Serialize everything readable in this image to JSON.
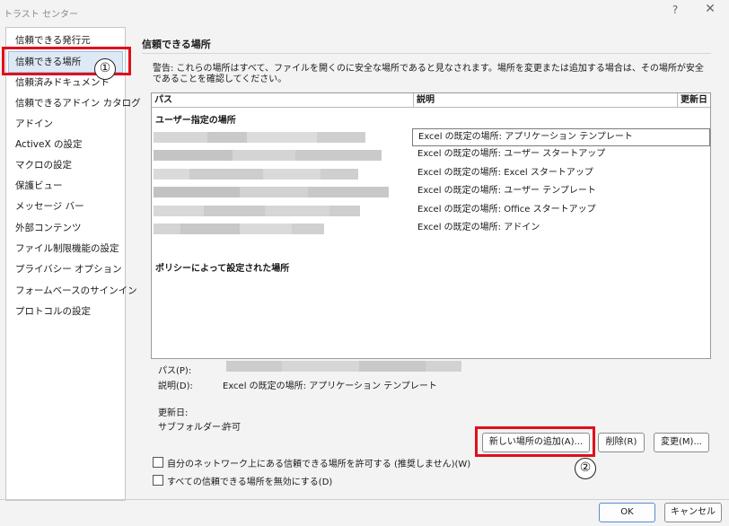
{
  "window": {
    "title": "トラスト センター",
    "help": "?",
    "close": "✕"
  },
  "sidebar": {
    "items": [
      {
        "label": "信頼できる発行元"
      },
      {
        "label": "信頼できる場所"
      },
      {
        "label": "信頼済みドキュメント"
      },
      {
        "label": "信頼できるアドイン カタログ"
      },
      {
        "label": "アドイン"
      },
      {
        "label": "ActiveX の設定"
      },
      {
        "label": "マクロの設定"
      },
      {
        "label": "保護ビュー"
      },
      {
        "label": "メッセージ バー"
      },
      {
        "label": "外部コンテンツ"
      },
      {
        "label": "ファイル制限機能の設定"
      },
      {
        "label": "プライバシー オプション"
      },
      {
        "label": "フォームベースのサインイン"
      },
      {
        "label": "プロトコルの設定"
      }
    ],
    "selected_index": 1
  },
  "main": {
    "title": "信頼できる場所",
    "warning": "警告: これらの場所はすべて、ファイルを開くのに安全な場所であると見なされます。場所を変更または追加する場合は、その場所が安全であることを確認してください。",
    "columns": {
      "path": "パス",
      "description": "説明",
      "modified": "更新日"
    },
    "user_group": "ユーザー指定の場所",
    "rows": [
      {
        "description": "Excel の既定の場所: アプリケーション テンプレート"
      },
      {
        "description": "Excel の既定の場所: ユーザー スタートアップ"
      },
      {
        "description": "Excel の既定の場所: Excel スタートアップ"
      },
      {
        "description": "Excel の既定の場所: ユーザー テンプレート"
      },
      {
        "description": "Excel の既定の場所: Office スタートアップ"
      },
      {
        "description": "Excel の既定の場所: アドイン"
      }
    ],
    "policy_group": "ポリシーによって設定された場所"
  },
  "details": {
    "path_label": "パス(P):",
    "description_label": "説明(D):",
    "description_value": "Excel の既定の場所: アプリケーション テンプレート",
    "modified_label": "更新日:",
    "subfolders_label": "サブフォルダー:",
    "subfolders_value": "許可"
  },
  "buttons": {
    "add": "新しい場所の追加(A)...",
    "remove": "削除(R)",
    "modify": "変更(M)...",
    "ok": "OK",
    "cancel": "キャンセル"
  },
  "checkboxes": {
    "network": "自分のネットワーク上にある信頼できる場所を許可する (推奨しません)(W)",
    "disable_all": "すべての信頼できる場所を無効にする(D)"
  },
  "annotations": {
    "badge1": "①",
    "badge2": "②",
    "color": "#e0101a"
  }
}
